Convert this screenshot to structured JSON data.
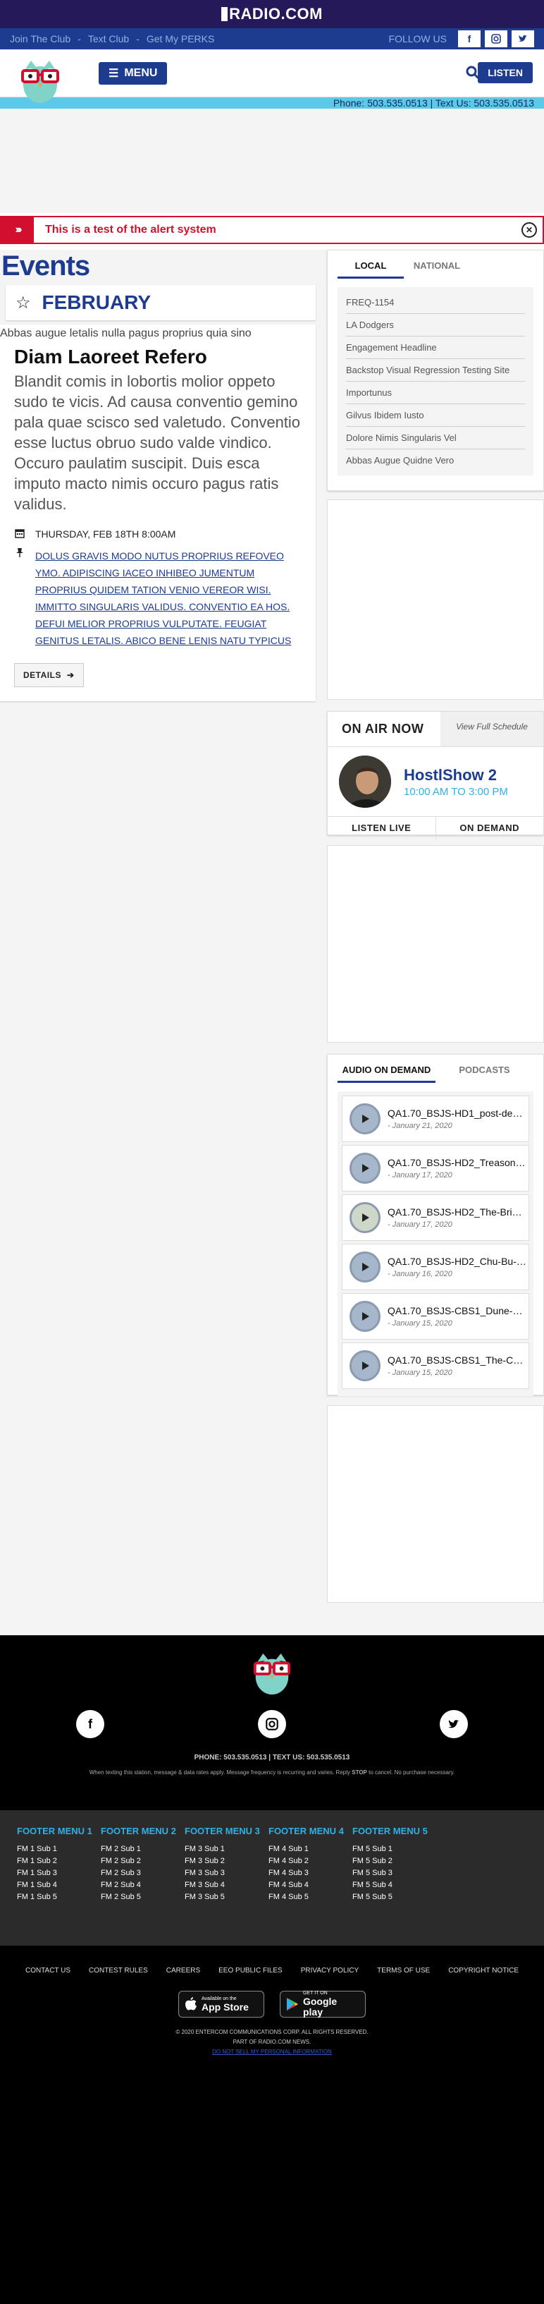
{
  "topbar": {
    "brand": "RADIO.COM"
  },
  "util": {
    "links": [
      "Join The Club",
      "Text Club",
      "Get My PERKS"
    ],
    "follow": "FOLLOW US"
  },
  "header": {
    "menu_label": "MENU",
    "listen_label": "LISTEN"
  },
  "phonebar": {
    "text": "Phone: 503.535.0513 | Text Us: 503.535.0513"
  },
  "alert": {
    "text": "This is a test of the alert system"
  },
  "events": {
    "title": "Events",
    "month": "FEBRUARY",
    "card": {
      "image_alt": "Abbas augue letalis nulla pagus proprius quia sino",
      "title": "Diam Laoreet Refero",
      "description": "Blandit comis in lobortis molior oppeto sudo te vicis. Ad causa conventio gemino pala quae scisco sed valetudo. Conventio esse luctus obruo sudo valde vindico. Occuro paulatim suscipit. Duis esca imputo macto nimis occuro pagus ratis validus.",
      "date": "THURSDAY, FEB 18TH 8:00AM",
      "location": "DOLUS GRAVIS MODO NUTUS PROPRIUS REFOVEO YMO. ADIPISCING IACEO INHIBEO JUMENTUM PROPRIUS QUIDEM TATION VENIO VEREOR WISI. IMMITTO SINGULARIS VALIDUS. CONVENTIO EA HOS. DEFUI MELIOR PROPRIUS VULPUTATE. FEUGIAT GENITUS LETALIS. ABICO BENE LENIS NATU TYPICUS",
      "details_label": "DETAILS"
    }
  },
  "news": {
    "tabs": [
      "LOCAL",
      "NATIONAL"
    ],
    "items": [
      "FREQ-1154",
      "LA Dodgers",
      "Engagement Headline",
      "Backstop Visual Regression Testing Site",
      "Importunus",
      "Gilvus Ibidem Iusto",
      "Dolore Nimis Singularis Vel",
      "Abbas Augue Quidne Vero"
    ]
  },
  "onair": {
    "title": "ON AIR NOW",
    "schedule": "View Full Schedule",
    "show": "HostlShow 2",
    "time": "10:00 AM TO 3:00 PM",
    "listen_live": "LISTEN LIVE",
    "on_demand": "ON DEMAND"
  },
  "aod": {
    "tabs": [
      "AUDIO ON DEMAND",
      "PODCASTS"
    ],
    "items": [
      {
        "title": "QA1.70_BSJS-HD1_post-depl…",
        "date": "- January 21, 2020"
      },
      {
        "title": "QA1.70_BSJS-HD2_Treason-…",
        "date": "- January 17, 2020"
      },
      {
        "title": "QA1.70_BSJS-HD2_The-Bride…",
        "date": "- January 17, 2020"
      },
      {
        "title": "QA1.70_BSJS-HD2_Chu-Bu-a…",
        "date": "- January 16, 2020"
      },
      {
        "title": "QA1.70_BSJS-CBS1_Dune-Cl…",
        "date": "- January 15, 2020"
      },
      {
        "title": "QA1.70_BSJS-CBS1_The-Cor…",
        "date": "- January 15, 2020"
      }
    ]
  },
  "footer": {
    "phone": "PHONE: 503.535.0513 | TEXT US: 503.535.0513",
    "disclaimer_pre": "When texting this station, message & data rates apply. Message frequency is recurring and varies. Reply ",
    "disclaimer_stop": "STOP",
    "disclaimer_post": " to cancel. No purchase necessary.",
    "menus": [
      {
        "title": "FOOTER MENU 1",
        "items": [
          "FM 1 Sub 1",
          "FM 1 Sub 2",
          "FM 1 Sub 3",
          "FM 1 Sub 4",
          "FM 1 Sub 5"
        ]
      },
      {
        "title": "FOOTER MENU 2",
        "items": [
          "FM 2 Sub 1",
          "FM 2 Sub 2",
          "FM 2 Sub 3",
          "FM 2 Sub 4",
          "FM 2 Sub 5"
        ]
      },
      {
        "title": "FOOTER MENU 3",
        "items": [
          "FM 3 Sub 1",
          "FM 3 Sub 2",
          "FM 3 Sub 3",
          "FM 3 Sub 4",
          "FM 3 Sub 5"
        ]
      },
      {
        "title": "FOOTER MENU 4",
        "items": [
          "FM 4 Sub 1",
          "FM 4 Sub 2",
          "FM 4 Sub 3",
          "FM 4 Sub 4",
          "FM 4 Sub 5"
        ]
      },
      {
        "title": "FOOTER MENU 5",
        "items": [
          "FM 5 Sub 1",
          "FM 5 Sub 2",
          "FM 5 Sub 3",
          "FM 5 Sub 4",
          "FM 5 Sub 5"
        ]
      }
    ],
    "links": [
      "CONTACT US",
      "CONTEST RULES",
      "CAREERS",
      "EEO PUBLIC FILES",
      "PRIVACY POLICY",
      "TERMS OF USE",
      "COPYRIGHT NOTICE"
    ],
    "appstore_small": "Available on the",
    "appstore_big": "App Store",
    "gplay_small": "GET IT ON",
    "gplay_big": "Google play",
    "copyright": "© 2020 ENTERCOM COMMUNICATIONS CORP. ALL RIGHTS RESERVED.",
    "part_of": "PART OF RADIO.COM NEWS.",
    "donotsell": "DO NOT SELL MY PERSONAL INFORMATION"
  }
}
